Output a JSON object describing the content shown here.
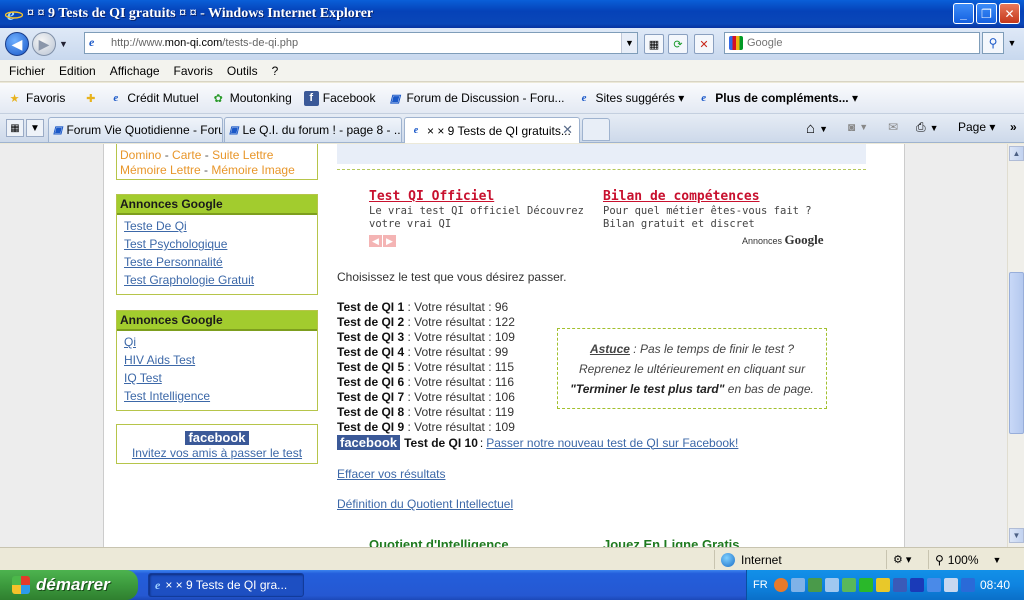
{
  "window": {
    "title": "¤ ¤ 9 Tests de QI gratuits ¤ ¤ - Windows Internet Explorer",
    "minimize": "_",
    "maximize": "❐",
    "close": "✕"
  },
  "address": {
    "url_prefix": "http://www.",
    "url_domain": "mon-qi.com",
    "url_path": "/tests-de-qi.php",
    "search_placeholder": "Google"
  },
  "menu": [
    "Fichier",
    "Edition",
    "Affichage",
    "Favoris",
    "Outils",
    "?"
  ],
  "favorites": {
    "favoris_label": "Favoris",
    "items": [
      "Crédit Mutuel",
      "Moutonking",
      "Facebook",
      "Forum de Discussion - Foru...",
      "Sites suggérés ▾",
      "Plus de compléments... ▾"
    ]
  },
  "tabs": [
    {
      "label": "Forum Vie Quotidienne - Foru..."
    },
    {
      "label": "Le Q.I. du forum ! - page 8 - ..."
    },
    {
      "label": "× × 9 Tests de QI gratuits..."
    }
  ],
  "command_bar": {
    "page_label": "Page ▾"
  },
  "sidebar": {
    "orange_links": [
      "Domino",
      "Carte",
      "Suite Lettre",
      "Mémoire Lettre",
      "Mémoire Image"
    ],
    "ads1": {
      "header": "Annonces Google",
      "links": [
        "Teste De Qi",
        "Test Psychologique",
        "Teste Personnalité",
        "Test Graphologie Gratuit"
      ]
    },
    "ads2": {
      "header": "Annonces Google",
      "links": [
        "Qi",
        "HIV Aids Test",
        "IQ Test",
        "Test Intelligence"
      ]
    },
    "facebook": {
      "logo": "facebook",
      "invite": "Invitez vos amis à passer le test"
    }
  },
  "main": {
    "ads": [
      {
        "title": "Test QI Officiel",
        "text": "Le vrai test QI officiel Découvrez votre vrai QI"
      },
      {
        "title": "Bilan de compétences",
        "text": "Pour quel métier êtes-vous fait ? Bilan gratuit et discret"
      }
    ],
    "annonces_prefix": "Annonces",
    "annonces_brand": "Google",
    "choose_text": "Choisissez le test que vous désirez passer.",
    "results_label": "Votre résultat :",
    "results": [
      {
        "test": "Test de QI 1",
        "score": "96"
      },
      {
        "test": "Test de QI 2",
        "score": "122"
      },
      {
        "test": "Test de QI 3",
        "score": "109"
      },
      {
        "test": "Test de QI 4",
        "score": "99"
      },
      {
        "test": "Test de QI 5",
        "score": "115"
      },
      {
        "test": "Test de QI 6",
        "score": "116"
      },
      {
        "test": "Test de QI 7",
        "score": "106"
      },
      {
        "test": "Test de QI 8",
        "score": "119"
      },
      {
        "test": "Test de QI 9",
        "score": "109"
      }
    ],
    "fb_test": {
      "logo": "facebook",
      "test": "Test de QI 10",
      "sep": ":",
      "link": "Passer notre nouveau test de QI sur Facebook!"
    },
    "astuce": {
      "title": "Astuce",
      "line1_rest": ": Pas le temps de finir le test ?",
      "line2": "Reprenez le ultérieurement en cliquant sur",
      "quote": "\"Terminer le test plus tard\"",
      "line3_rest": "en bas de page."
    },
    "erase_link": "Effacer vos résultats",
    "definition_link": "Définition du Quotient Intellectuel",
    "bottom_titles": [
      "Quotient d'Intelligence",
      "Jouez En Ligne Gratis"
    ]
  },
  "status": {
    "zone": "Internet",
    "zoom": "100%"
  },
  "taskbar": {
    "start": "démarrer",
    "window_btn": "× × 9 Tests de QI gra...",
    "lang": "FR",
    "clock": "08:40"
  }
}
